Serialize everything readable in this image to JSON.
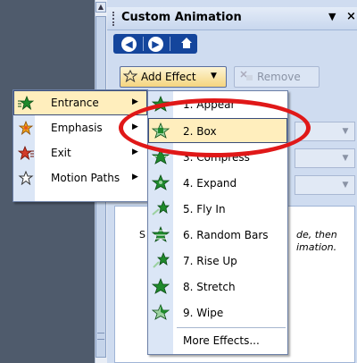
{
  "task_pane": {
    "title": "Custom Animation",
    "dropdown_arrow": "▼",
    "close": "×",
    "nav": {
      "back_symbol": "◀",
      "forward_symbol": "▶",
      "home_icon": "home-icon"
    },
    "add_effect": {
      "label": "Add Effect",
      "caret": "▼",
      "icon": "star-add-icon"
    },
    "remove": {
      "label": "Remove",
      "icon": "remove-icon"
    },
    "hint_right": "de, then\nimation.",
    "hint_left": "S"
  },
  "add_effect_menu": {
    "items": [
      {
        "label": "Entrance",
        "icon": "entrance-star-icon",
        "selected": true,
        "accent": "#1f8a2c"
      },
      {
        "label": "Emphasis",
        "icon": "emphasis-star-icon",
        "selected": false,
        "accent": "#e69a1a"
      },
      {
        "label": "Exit",
        "icon": "exit-star-icon",
        "selected": false,
        "accent": "#d23c2a"
      },
      {
        "label": "Motion Paths",
        "icon": "motion-path-star-icon",
        "selected": false,
        "accent": "#555555"
      }
    ]
  },
  "entrance_menu": {
    "items": [
      {
        "label": "1. Appear",
        "icon": "appear-icon"
      },
      {
        "label": "2. Box",
        "icon": "box-icon",
        "selected": true
      },
      {
        "label": "3. Compress",
        "icon": "compress-icon"
      },
      {
        "label": "4. Expand",
        "icon": "expand-icon"
      },
      {
        "label": "5. Fly In",
        "icon": "fly-in-icon"
      },
      {
        "label": "6. Random Bars",
        "icon": "random-bars-icon"
      },
      {
        "label": "7. Rise Up",
        "icon": "rise-up-icon"
      },
      {
        "label": "8. Stretch",
        "icon": "stretch-icon"
      },
      {
        "label": "9. Wipe",
        "icon": "wipe-icon"
      }
    ],
    "more": "More Effects..."
  },
  "colors": {
    "highlight_ring": "#e01818",
    "menu_selected": "#ffeebd",
    "nav_bar": "#14459c"
  }
}
